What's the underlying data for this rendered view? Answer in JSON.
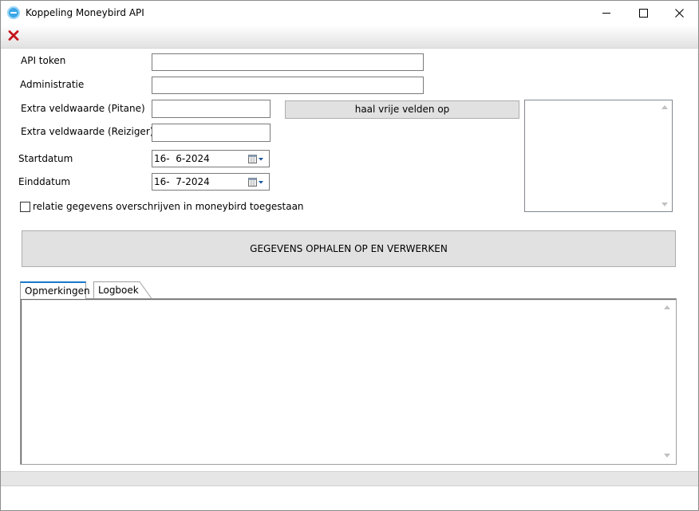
{
  "window": {
    "title": "Koppeling Moneybird API"
  },
  "form": {
    "api_token_label": "API token",
    "api_token_value": "",
    "administratie_label": "Administratie",
    "administratie_value": "",
    "extra_pitane_label": "Extra veldwaarde  (Pitane)",
    "extra_pitane_value": "",
    "extra_reiziger_label": "Extra veldwaarde  (Reiziger)",
    "extra_reiziger_value": "",
    "startdatum_label": "Startdatum",
    "startdatum_value": "16-  6-2024",
    "einddatum_label": "Einddatum",
    "einddatum_value": "16-  7-2024",
    "checkbox_label": "relatie gegevens overschrijven in moneybird toegestaan",
    "checkbox_checked": false
  },
  "buttons": {
    "haal_label": "haal vrije velden op",
    "process_label": "GEGEVENS OPHALEN OP EN VERWERKEN"
  },
  "tabs": [
    {
      "label": "Opmerkingen",
      "active": true
    },
    {
      "label": "Logboek",
      "active": false
    }
  ],
  "icons": {
    "app": "moneybird-app-icon",
    "toolbar_close": "red-x-close-icon",
    "calendar": "calendar-dropdown-icon"
  },
  "colors": {
    "toolbar_close_red": "#c4161c",
    "active_tab_accent": "#1979ca",
    "button_face": "#e1e1e1"
  }
}
